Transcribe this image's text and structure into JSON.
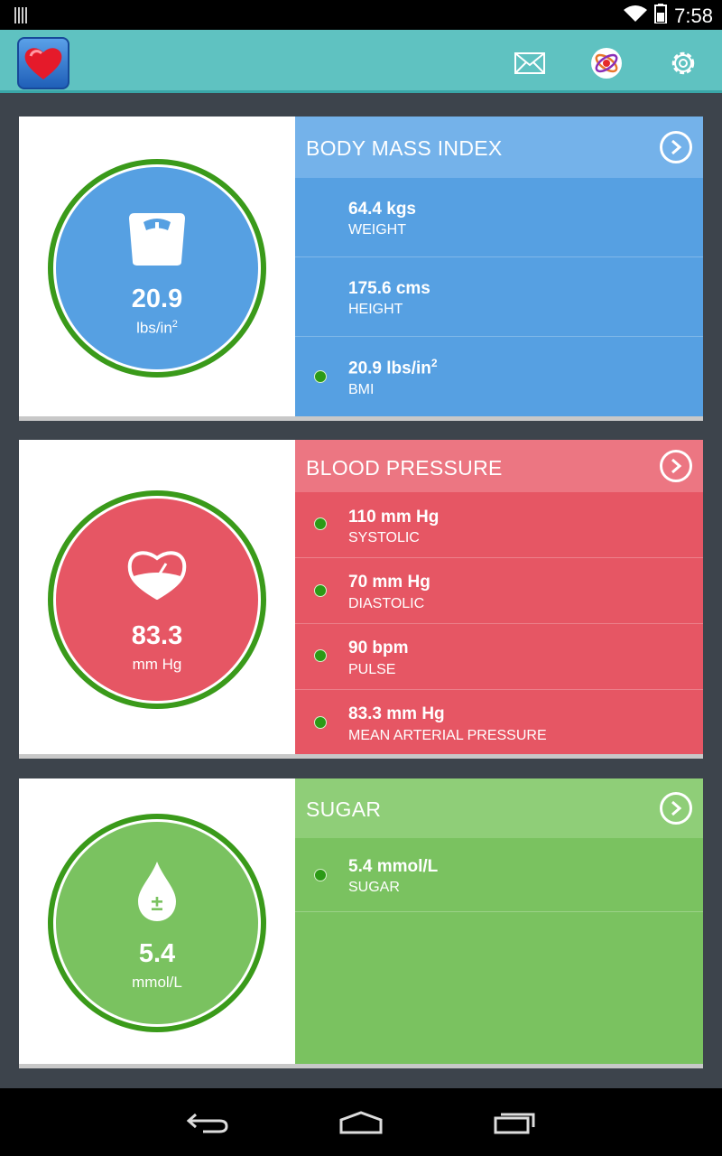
{
  "status": {
    "time": "7:58",
    "icons": [
      "notification-bars-icon",
      "wifi-icon",
      "battery-icon"
    ]
  },
  "appbar": {
    "icons": [
      "heart-app-icon",
      "mail-icon",
      "atom-badge-icon",
      "gear-icon"
    ]
  },
  "colors": {
    "teal": "#5fc2c1",
    "bmi": "#56a0e2",
    "bmi_header": "#74b2ea",
    "bp": "#e65664",
    "bp_header": "#ec7682",
    "sugar": "#7ac260",
    "sugar_header": "#8fce78",
    "ring": "#3a9a1a",
    "dot": "#2c9a16"
  },
  "cards": {
    "bmi": {
      "title": "BODY MASS INDEX",
      "gauge_value": "20.9",
      "gauge_unit": "lbs/in",
      "gauge_unit_sup": "2",
      "rows": [
        {
          "value": "64.4 kgs",
          "label": "WEIGHT",
          "dot": false
        },
        {
          "value": "175.6 cms",
          "label": "HEIGHT",
          "dot": false
        },
        {
          "value": "20.9 lbs/in",
          "sup": "2",
          "label": "BMI",
          "dot": true
        }
      ]
    },
    "bp": {
      "title": "BLOOD PRESSURE",
      "gauge_value": "83.3",
      "gauge_unit": "mm Hg",
      "rows": [
        {
          "value": "110 mm Hg",
          "label": "SYSTOLIC",
          "dot": true
        },
        {
          "value": "70 mm Hg",
          "label": "DIASTOLIC",
          "dot": true
        },
        {
          "value": "90 bpm",
          "label": "PULSE",
          "dot": true
        },
        {
          "value": "83.3 mm Hg",
          "label": "MEAN ARTERIAL PRESSURE",
          "dot": true
        }
      ]
    },
    "sugar": {
      "title": "SUGAR",
      "gauge_value": "5.4",
      "gauge_unit": "mmol/L",
      "rows": [
        {
          "value": "5.4 mmol/L",
          "label": "SUGAR",
          "dot": true
        }
      ]
    }
  },
  "navbar": {
    "icons": [
      "back-icon",
      "home-icon",
      "recents-icon"
    ]
  }
}
